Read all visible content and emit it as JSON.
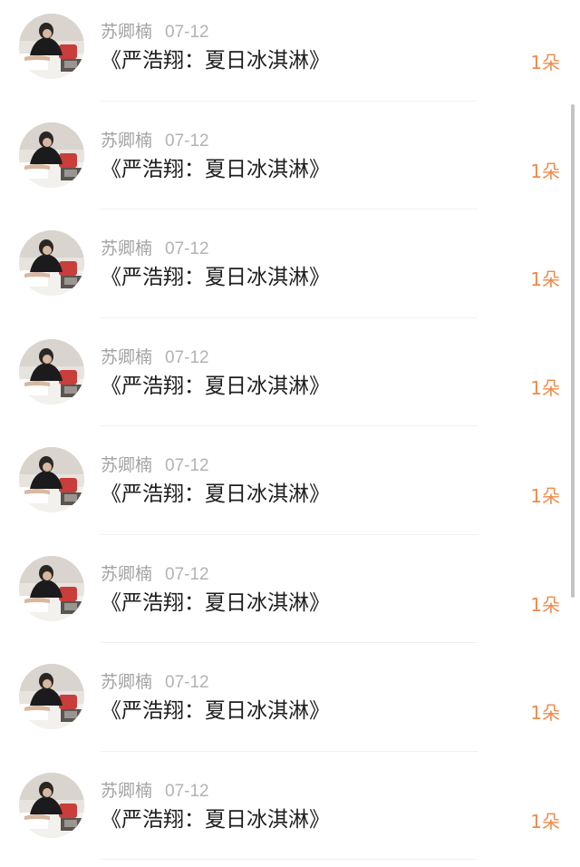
{
  "items": [
    {
      "user": "苏卿楠",
      "date": "07-12",
      "title": "《严浩翔：夏日冰淇淋》",
      "count": "1朵"
    },
    {
      "user": "苏卿楠",
      "date": "07-12",
      "title": "《严浩翔：夏日冰淇淋》",
      "count": "1朵"
    },
    {
      "user": "苏卿楠",
      "date": "07-12",
      "title": "《严浩翔：夏日冰淇淋》",
      "count": "1朵"
    },
    {
      "user": "苏卿楠",
      "date": "07-12",
      "title": "《严浩翔：夏日冰淇淋》",
      "count": "1朵"
    },
    {
      "user": "苏卿楠",
      "date": "07-12",
      "title": "《严浩翔：夏日冰淇淋》",
      "count": "1朵"
    },
    {
      "user": "苏卿楠",
      "date": "07-12",
      "title": "《严浩翔：夏日冰淇淋》",
      "count": "1朵"
    },
    {
      "user": "苏卿楠",
      "date": "07-12",
      "title": "《严浩翔：夏日冰淇淋》",
      "count": "1朵"
    },
    {
      "user": "苏卿楠",
      "date": "07-12",
      "title": "《严浩翔：夏日冰淇淋》",
      "count": "1朵"
    }
  ],
  "colors": {
    "username": "#a3a3a3",
    "date": "#b3b3b3",
    "title": "#1e1e1e",
    "count_accent": "#ef8a4a",
    "divider": "#f1f1f1"
  }
}
